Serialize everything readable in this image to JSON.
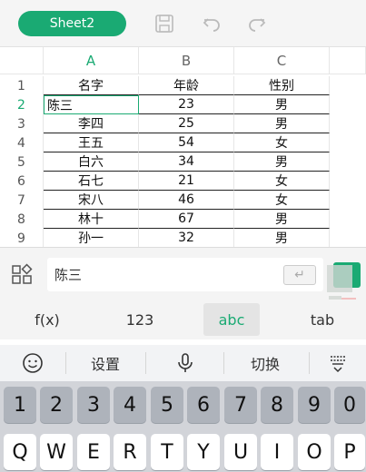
{
  "toolbar": {
    "sheet_tab": "Sheet2",
    "icons": [
      "save-icon",
      "undo-icon",
      "redo-icon"
    ]
  },
  "grid": {
    "columns": [
      "A",
      "B",
      "C"
    ],
    "headers": {
      "row": "1",
      "cells": [
        "名字",
        "年龄",
        "性别"
      ]
    },
    "rows": [
      {
        "num": "2",
        "cells": [
          "陈三",
          "23",
          "男"
        ]
      },
      {
        "num": "3",
        "cells": [
          "李四",
          "25",
          "男"
        ]
      },
      {
        "num": "4",
        "cells": [
          "王五",
          "54",
          "女"
        ]
      },
      {
        "num": "5",
        "cells": [
          "白六",
          "34",
          "男"
        ]
      },
      {
        "num": "6",
        "cells": [
          "石七",
          "21",
          "女"
        ]
      },
      {
        "num": "7",
        "cells": [
          "宋八",
          "46",
          "女"
        ]
      },
      {
        "num": "8",
        "cells": [
          "林十",
          "67",
          "男"
        ]
      },
      {
        "num": "9",
        "cells": [
          "孙一",
          "32",
          "男"
        ]
      }
    ],
    "selected_cell": "A2"
  },
  "editbar": {
    "value": "陈三",
    "enter_glyph": "↵"
  },
  "modes": {
    "fx": "f(x)",
    "num": "123",
    "abc": "abc",
    "tab": "tab",
    "active": "abc"
  },
  "ime_bar": {
    "emoji": "emoji-icon",
    "settings": "设置",
    "voice": "microphone-icon",
    "switch": "切换",
    "collapse": "keyboard-collapse-icon"
  },
  "keyboard": {
    "numbers": [
      "1",
      "2",
      "3",
      "4",
      "5",
      "6",
      "7",
      "8",
      "9",
      "0"
    ],
    "letters": [
      "Q",
      "W",
      "E",
      "R",
      "T",
      "Y",
      "U",
      "I",
      "O",
      "P"
    ]
  },
  "colors": {
    "accent": "#1aaa73"
  }
}
